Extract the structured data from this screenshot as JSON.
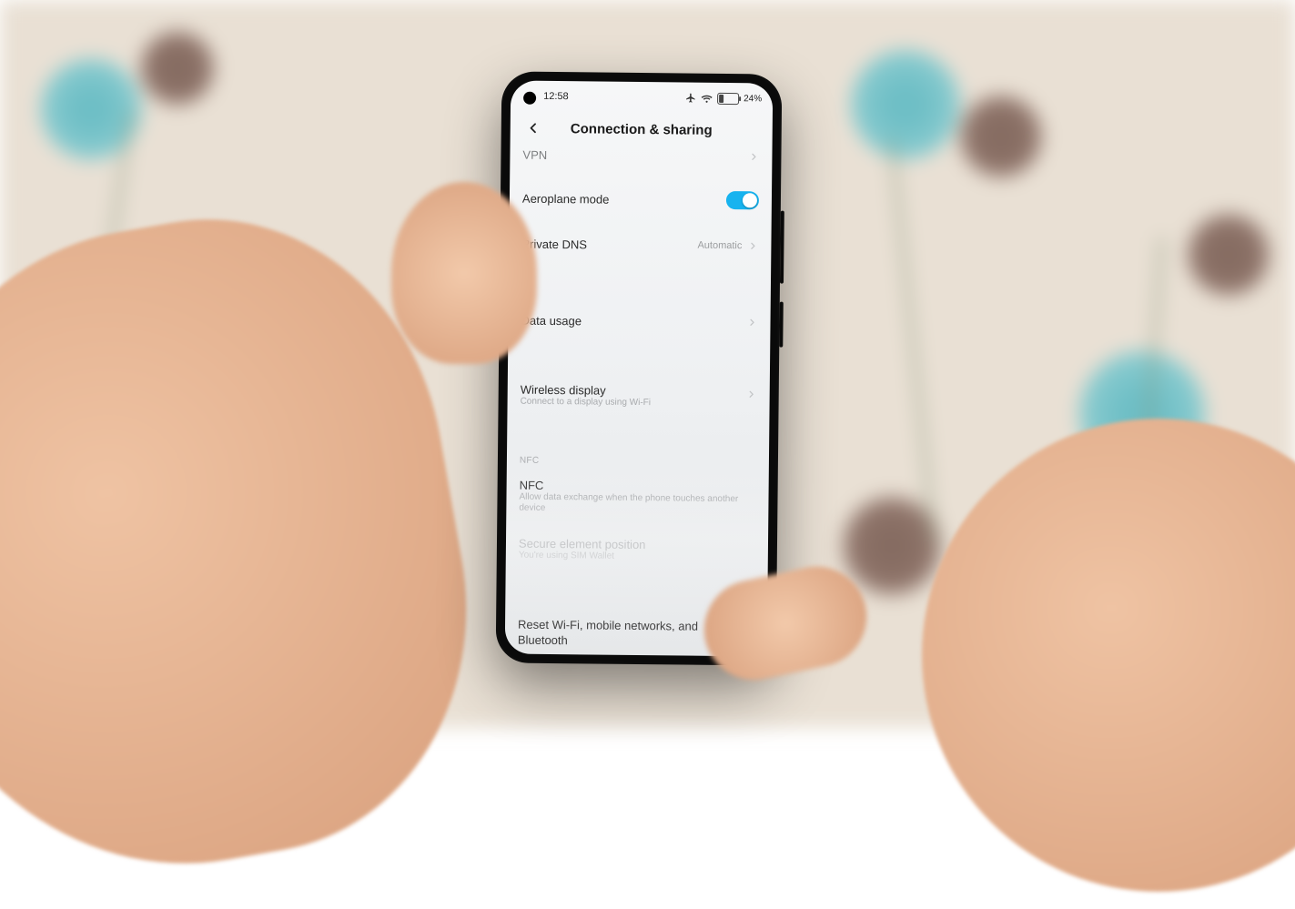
{
  "status_bar": {
    "time": "12:58",
    "airplane_icon": "airplane",
    "wifi_icon": "wifi",
    "battery_percent_text": "24%",
    "battery_level": 24
  },
  "header": {
    "title": "Connection & sharing"
  },
  "rows": {
    "vpn": {
      "title": "VPN"
    },
    "airplane": {
      "title": "Aeroplane mode",
      "on": true
    },
    "private_dns": {
      "title": "Private DNS",
      "value": "Automatic"
    },
    "data_usage": {
      "title": "Data usage"
    },
    "wireless_disp": {
      "title": "Wireless display",
      "sub": "Connect to a display using Wi-Fi"
    },
    "nfc_section": {
      "label": "NFC"
    },
    "nfc": {
      "title": "NFC",
      "sub": "Allow data exchange when the phone touches another device"
    },
    "secure_element": {
      "title": "Secure element position",
      "sub": "You're using SIM Wallet"
    },
    "reset": {
      "title": "Reset Wi-Fi, mobile networks, and Bluetooth"
    }
  }
}
